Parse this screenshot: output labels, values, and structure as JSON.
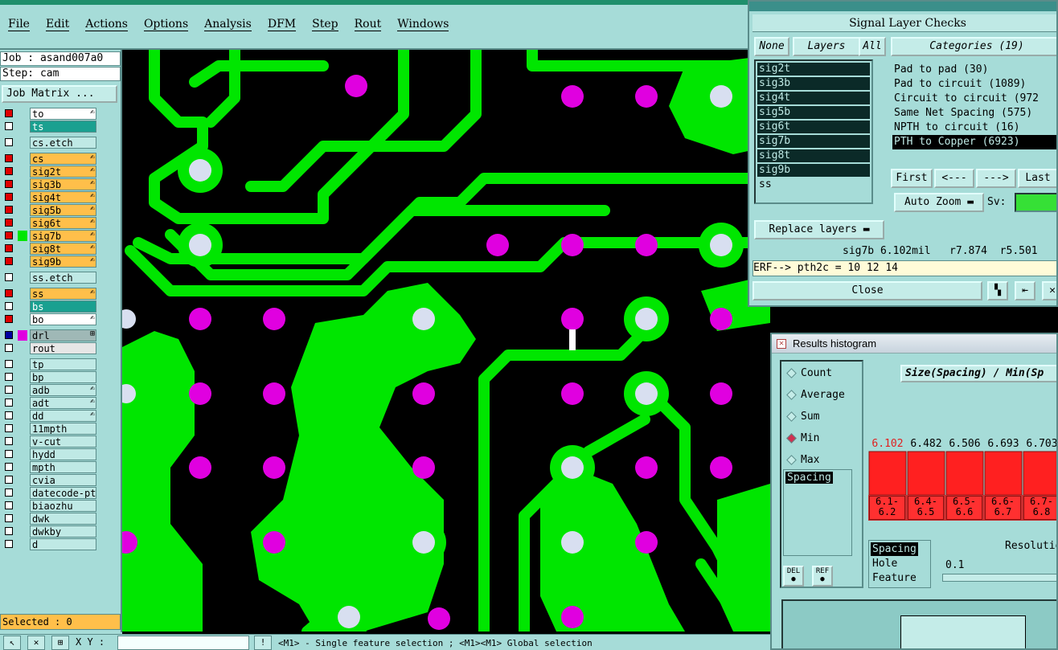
{
  "menubar": {
    "items": [
      {
        "label": "File"
      },
      {
        "label": "Edit"
      },
      {
        "label": "Actions"
      },
      {
        "label": "Options"
      },
      {
        "label": "Analysis"
      },
      {
        "label": "DFM"
      },
      {
        "label": "Step"
      },
      {
        "label": "Rout"
      },
      {
        "label": "Windows"
      }
    ]
  },
  "leftpanel": {
    "job": "Job : asand007a0",
    "step": "Step: cam",
    "job_matrix": "Job Matrix ...",
    "layers": [
      {
        "name": "to",
        "color": "white",
        "mark": "✍"
      },
      {
        "name": "ts",
        "color": "teal",
        "mark": ""
      },
      {
        "name": "cs.etch",
        "color": "cyan",
        "mark": ""
      },
      {
        "name": "cs",
        "color": "orange",
        "mark": "✍"
      },
      {
        "name": "sig2t",
        "color": "orange",
        "mark": "✍"
      },
      {
        "name": "sig3b",
        "color": "orange",
        "mark": "✍"
      },
      {
        "name": "sig4t",
        "color": "orange",
        "mark": "✍"
      },
      {
        "name": "sig5b",
        "color": "orange",
        "mark": "✍"
      },
      {
        "name": "sig6t",
        "color": "orange",
        "mark": "✍"
      },
      {
        "name": "sig7b",
        "color": "orange",
        "mark": "✍"
      },
      {
        "name": "sig8t",
        "color": "orange",
        "mark": "✍"
      },
      {
        "name": "sig9b",
        "color": "orange",
        "mark": "✍"
      },
      {
        "name": "ss.etch",
        "color": "cyan",
        "mark": ""
      },
      {
        "name": "ss",
        "color": "orange",
        "mark": "✍"
      },
      {
        "name": "bs",
        "color": "teal",
        "mark": ""
      },
      {
        "name": "bo",
        "color": "white",
        "mark": "✍"
      },
      {
        "name": "drl",
        "color": "gray",
        "mark": "⊞"
      },
      {
        "name": "rout",
        "color": "silver",
        "mark": ""
      },
      {
        "name": "tp",
        "color": "cyan",
        "mark": ""
      },
      {
        "name": "bp",
        "color": "cyan",
        "mark": ""
      },
      {
        "name": "adb",
        "color": "cyan",
        "mark": "✍"
      },
      {
        "name": "adt",
        "color": "cyan",
        "mark": "✍"
      },
      {
        "name": "dd",
        "color": "cyan",
        "mark": "✍"
      },
      {
        "name": "11mpth",
        "color": "cyan",
        "mark": ""
      },
      {
        "name": "v-cut",
        "color": "cyan",
        "mark": ""
      },
      {
        "name": "hydd",
        "color": "cyan",
        "mark": ""
      },
      {
        "name": "mpth",
        "color": "cyan",
        "mark": ""
      },
      {
        "name": "cvia",
        "color": "cyan",
        "mark": ""
      },
      {
        "name": "datecode-pth",
        "color": "cyan",
        "mark": ""
      },
      {
        "name": "biaozhu",
        "color": "cyan",
        "mark": ""
      },
      {
        "name": "dwk",
        "color": "cyan",
        "mark": ""
      },
      {
        "name": "dwkby",
        "color": "cyan",
        "mark": ""
      },
      {
        "name": "d",
        "color": "cyan",
        "mark": ""
      }
    ],
    "selected": "Selected : 0"
  },
  "statusbar": {
    "xy_label": "X Y :",
    "xy_value": "",
    "hint": "<M1> - Single feature selection ; <M1><M1> Global selection"
  },
  "viewer": {
    "title": "Signal Layer Checks",
    "none_label": "None",
    "layers_label": "Layers",
    "all_label": "All",
    "categories_label": "Categories (19)",
    "sig_layers": [
      "sig2t",
      "sig3b",
      "sig4t",
      "sig5b",
      "sig6t",
      "sig7b",
      "sig8t",
      "sig9b",
      "ss"
    ],
    "categories": [
      "Pad to pad (30)",
      "Pad to circuit (1089)",
      "Circuit to circuit (972",
      "Same Net Spacing (575)",
      "NPTH to circuit (16)",
      "PTH to Copper (6923)"
    ],
    "first_label": "First",
    "prev_label": "<---",
    "next_label": "--->",
    "last_label": "Last",
    "auto_zoom_label": "Auto Zoom",
    "sv_label": "Sv:",
    "replace_layers_label": "Replace layers",
    "dimension_line": "sig7b 6.102mil   r7.874  r5.501",
    "erf_line": "ERF--> pth2c = 10 12 14",
    "close_label": "Close"
  },
  "histogram": {
    "title": "Results histogram",
    "modes": [
      "Count",
      "Average",
      "Sum",
      "Min",
      "Max"
    ],
    "selected_mode": "Min",
    "spacing_item": "Spacing",
    "chart_title": "Size(Spacing) / Min(Sp",
    "del_label": "DEL",
    "ref_label": "REF",
    "measures": [
      "Spacing",
      "Hole",
      "Feature"
    ],
    "resolution_label": "Resolutio",
    "resolution_value": "0.1"
  },
  "chart_data": {
    "type": "bar",
    "categories": [
      "6.1-6.2",
      "6.4-6.5",
      "6.5-6.6",
      "6.6-6.7",
      "6.7-6.8"
    ],
    "values": [
      6.102,
      6.482,
      6.506,
      6.693,
      6.703
    ],
    "value_labels": [
      "6.102",
      "6.482",
      "6.506",
      "6.693",
      "6.703"
    ],
    "title": "Size(Spacing) / Min(Sp",
    "colors": {
      "bar": "#ff2020",
      "first_label": "#e02020",
      "label": "#000000"
    }
  }
}
